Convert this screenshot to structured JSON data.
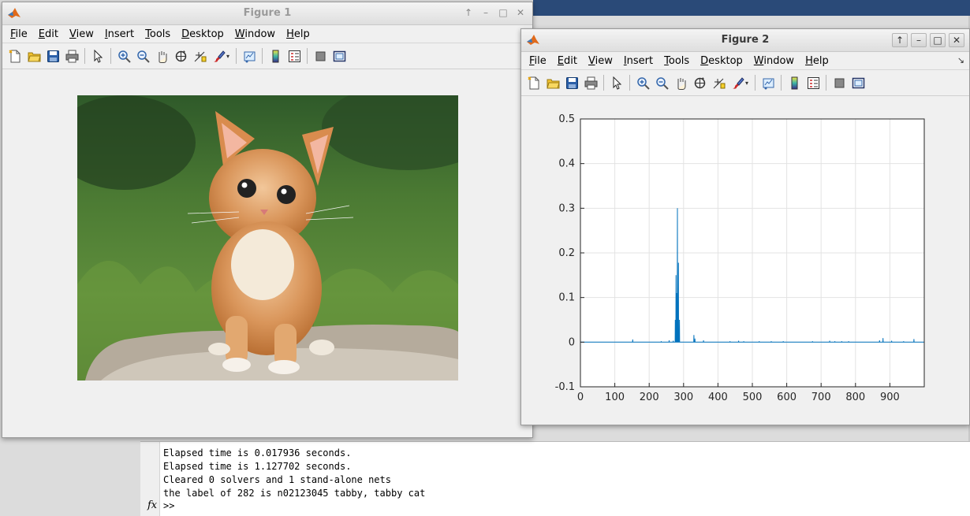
{
  "figure1": {
    "title": "Figure 1",
    "menu": [
      {
        "first": "F",
        "rest": "ile"
      },
      {
        "first": "E",
        "rest": "dit"
      },
      {
        "first": "V",
        "rest": "iew"
      },
      {
        "first": "I",
        "rest": "nsert"
      },
      {
        "first": "T",
        "rest": "ools"
      },
      {
        "first": "D",
        "rest": "esktop"
      },
      {
        "first": "W",
        "rest": "indow"
      },
      {
        "first": "H",
        "rest": "elp"
      }
    ],
    "image": {
      "subject": "orange tabby kitten on a rock with green grass background"
    }
  },
  "figure2": {
    "title": "Figure 2",
    "menu": [
      {
        "first": "F",
        "rest": "ile"
      },
      {
        "first": "E",
        "rest": "dit"
      },
      {
        "first": "V",
        "rest": "iew"
      },
      {
        "first": "I",
        "rest": "nsert"
      },
      {
        "first": "T",
        "rest": "ools"
      },
      {
        "first": "D",
        "rest": "esktop"
      },
      {
        "first": "W",
        "rest": "indow"
      },
      {
        "first": "H",
        "rest": "elp"
      }
    ]
  },
  "toolbar_icons": [
    "new-file-icon",
    "open-file-icon",
    "save-icon",
    "print-icon",
    "|",
    "select-arrow-icon",
    "|",
    "zoom-in-icon",
    "zoom-out-icon",
    "pan-hand-icon",
    "rotate-3d-icon",
    "data-cursor-icon",
    "brush-icon",
    "dropdown",
    "|",
    "link-plot-icon",
    "|",
    "colorbar-icon",
    "legend-icon",
    "|",
    "hide-plot-tools-icon",
    "show-plot-tools-icon"
  ],
  "chart_data": {
    "type": "line",
    "title": "",
    "xlabel": "",
    "ylabel": "",
    "xlim": [
      0,
      1000
    ],
    "ylim": [
      -0.1,
      0.5
    ],
    "xticks": [
      "0",
      "100",
      "200",
      "300",
      "400",
      "500",
      "600",
      "700",
      "800",
      "900"
    ],
    "yticks": [
      "-0.1",
      "0",
      "0.1",
      "0.2",
      "0.3",
      "0.4",
      "0.5"
    ],
    "grid": true,
    "color": "#0072bd",
    "spikes": [
      {
        "x": 152,
        "y": 0.006
      },
      {
        "x": 235,
        "y": 0.002
      },
      {
        "x": 258,
        "y": 0.004
      },
      {
        "x": 270,
        "y": 0.003
      },
      {
        "x": 276,
        "y": 0.05
      },
      {
        "x": 278,
        "y": 0.15
      },
      {
        "x": 280,
        "y": 0.11
      },
      {
        "x": 282,
        "y": 0.3
      },
      {
        "x": 284,
        "y": 0.05
      },
      {
        "x": 285,
        "y": 0.178
      },
      {
        "x": 288,
        "y": 0.05
      },
      {
        "x": 330,
        "y": 0.016
      },
      {
        "x": 333,
        "y": 0.008
      },
      {
        "x": 358,
        "y": 0.004
      },
      {
        "x": 435,
        "y": 0.002
      },
      {
        "x": 460,
        "y": 0.003
      },
      {
        "x": 475,
        "y": 0.002
      },
      {
        "x": 520,
        "y": 0.002
      },
      {
        "x": 555,
        "y": 0.002
      },
      {
        "x": 590,
        "y": 0.002
      },
      {
        "x": 675,
        "y": 0.002
      },
      {
        "x": 725,
        "y": 0.003
      },
      {
        "x": 740,
        "y": 0.002
      },
      {
        "x": 760,
        "y": 0.002
      },
      {
        "x": 780,
        "y": 0.002
      },
      {
        "x": 870,
        "y": 0.004
      },
      {
        "x": 880,
        "y": 0.009
      },
      {
        "x": 905,
        "y": 0.003
      },
      {
        "x": 940,
        "y": 0.002
      },
      {
        "x": 970,
        "y": 0.007
      }
    ]
  },
  "command_window": {
    "lines": [
      "Elapsed time is 0.017936 seconds.",
      "Elapsed time is 1.127702 seconds.",
      "Cleared 0 solvers and 1 stand-alone nets",
      "the label of 282 is n02123045 tabby, tabby cat"
    ],
    "fx_label": "fx",
    "prompt": ">>"
  }
}
